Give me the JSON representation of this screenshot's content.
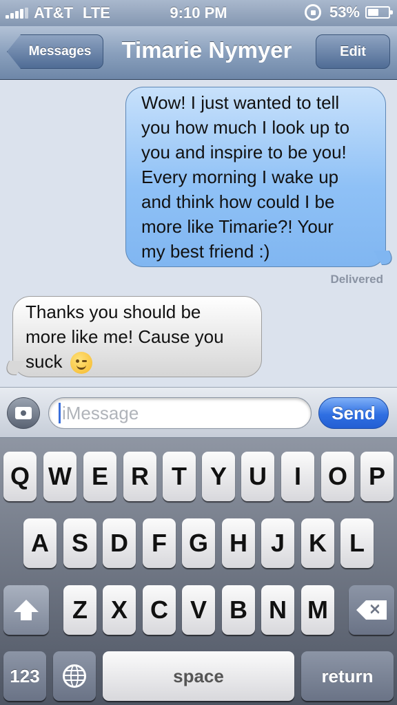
{
  "status_bar": {
    "carrier": "AT&T",
    "network": "LTE",
    "time": "9:10 PM",
    "battery": "53%",
    "battery_level": 0.53,
    "icons": [
      "signal-bars-icon",
      "rotation-lock-icon",
      "battery-icon"
    ]
  },
  "nav": {
    "back_label": "Messages",
    "title": "Timarie Nymyer",
    "edit_label": "Edit"
  },
  "messages": [
    {
      "direction": "outgoing",
      "lines": [
        "Wow! I just wanted to tell",
        "you how much I look up to",
        "you and inspire to be you!",
        "Every morning I wake up",
        "and think how could I be",
        "more like Timarie?! Your",
        "my best friend :)"
      ]
    },
    {
      "direction": "incoming",
      "lines": [
        "Thanks you should be",
        "more like me! Cause you",
        "suck"
      ],
      "emoji": "winking-face"
    }
  ],
  "delivered_label": "Delivered",
  "composer": {
    "placeholder": "iMessage",
    "send_label": "Send",
    "camera_icon": "camera-icon"
  },
  "keyboard": {
    "row1": [
      "Q",
      "W",
      "E",
      "R",
      "T",
      "Y",
      "U",
      "I",
      "O",
      "P"
    ],
    "row2": [
      "A",
      "S",
      "D",
      "F",
      "G",
      "H",
      "J",
      "K",
      "L"
    ],
    "row3": [
      "Z",
      "X",
      "C",
      "V",
      "B",
      "N",
      "M"
    ],
    "numbers_label": "123",
    "space_label": "space",
    "return_label": "return",
    "delete_symbol": "✕"
  }
}
